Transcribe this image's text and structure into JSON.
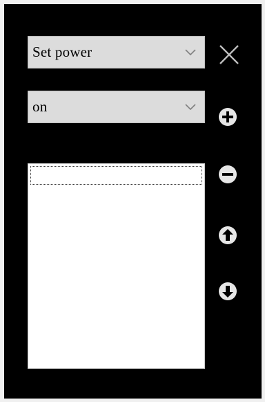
{
  "action_select": {
    "selected": "Set power",
    "icon": "chevron-down-icon"
  },
  "value_select": {
    "selected": "on",
    "icon": "chevron-down-icon"
  },
  "buttons": {
    "close_icon": "close-icon",
    "add_icon": "plus-circle-icon",
    "remove_icon": "minus-circle-icon",
    "up_icon": "arrow-up-circle-icon",
    "down_icon": "arrow-down-circle-icon"
  },
  "list": {
    "items": [
      ""
    ]
  },
  "colors": {
    "panel_background": "#000000",
    "select_background": "#dcdcdc",
    "icon_color": "#e6e6e6",
    "list_background": "#ffffff"
  }
}
